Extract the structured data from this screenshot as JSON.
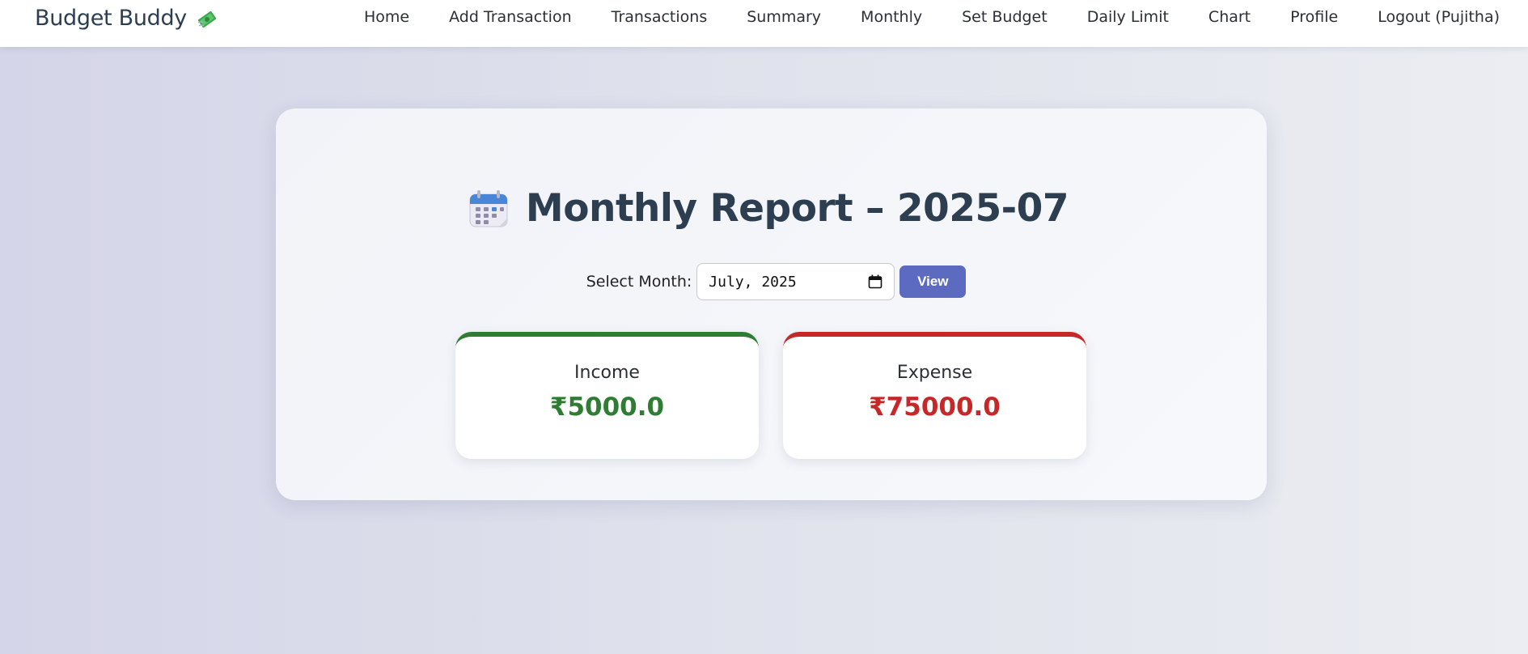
{
  "brand": {
    "name": "Budget Buddy",
    "icon": "money-with-wings-icon"
  },
  "nav": {
    "items": [
      {
        "label": "Home"
      },
      {
        "label": "Add Transaction"
      },
      {
        "label": "Transactions"
      },
      {
        "label": "Summary"
      },
      {
        "label": "Monthly"
      },
      {
        "label": "Set Budget"
      },
      {
        "label": "Daily Limit"
      },
      {
        "label": "Chart"
      },
      {
        "label": "Profile"
      },
      {
        "label": "Logout (Pujitha)"
      }
    ]
  },
  "report": {
    "icon": "calendar-icon",
    "title": "Monthly Report – 2025-07",
    "form": {
      "label": "Select Month:",
      "value": "July, 2025",
      "button_label": "View"
    },
    "income": {
      "label": "Income",
      "value": "₹5000.0",
      "color": "#2e7d32"
    },
    "expense": {
      "label": "Expense",
      "value": "₹75000.0",
      "color": "#c62828"
    }
  },
  "colors": {
    "accent": "#5c6bc0",
    "heading": "#2c3e50"
  }
}
